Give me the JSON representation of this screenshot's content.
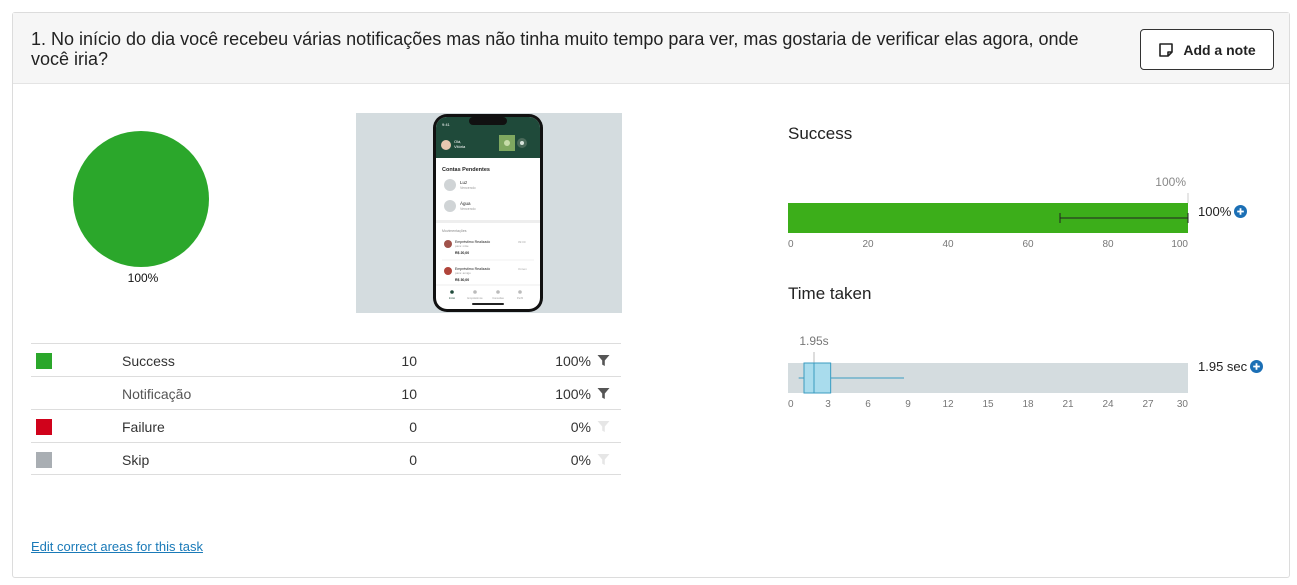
{
  "question": {
    "text": "1. No início do dia você recebeu várias notificações mas não tinha muito tempo para ver, mas gostaria de verificar elas agora, onde você iria?"
  },
  "toolbar": {
    "add_note_label": "Add a note"
  },
  "pie": {
    "label": "100%",
    "success_fraction": 1.0,
    "color": "#2ba72b"
  },
  "results": [
    {
      "label": "Success",
      "count": "10",
      "percent": "100%",
      "color": "#2ba72b",
      "filter_active": true
    },
    {
      "label": "Notificação",
      "count": "10",
      "percent": "100%",
      "color": null,
      "filter_active": true
    },
    {
      "label": "Failure",
      "count": "0",
      "percent": "0%",
      "color": "#d0021b",
      "filter_active": false
    },
    {
      "label": "Skip",
      "count": "0",
      "percent": "0%",
      "color": "#a9aeb3",
      "filter_active": false
    }
  ],
  "edit_link": "Edit correct areas for this task",
  "success_chart": {
    "title": "Success",
    "top_label": "100%",
    "side_value": "100%",
    "ticks": [
      "0",
      "20",
      "40",
      "60",
      "80",
      "100"
    ],
    "chart_data": {
      "type": "bar",
      "value": 100,
      "error_low": 68,
      "error_high": 100,
      "xlim": [
        0,
        100
      ],
      "color": "#3cae1a"
    }
  },
  "time_chart": {
    "title": "Time taken",
    "top_label": "1.95s",
    "side_value": "1.95 sec",
    "ticks": [
      "0",
      "3",
      "6",
      "9",
      "12",
      "15",
      "18",
      "21",
      "24",
      "27",
      "30"
    ],
    "chart_data": {
      "type": "box",
      "whisker_low": 0.8,
      "q1": 1.2,
      "median": 1.95,
      "q3": 3.2,
      "whisker_high": 8.7,
      "xlim": [
        0,
        30
      ],
      "color": "#a9dced"
    }
  },
  "phone": {
    "time": "9:41",
    "user_line1": "Olá,",
    "user_line2": "Vitória",
    "section_title": "Contas Pendentes",
    "bills": [
      {
        "title": "Luz",
        "sub": "Vencendo"
      },
      {
        "title": "Água",
        "sub": "Vencendo"
      }
    ],
    "notif_title": "Movimentações",
    "notifications": [
      {
        "title": "Empréstimo Realizado",
        "sub": "para: mãe",
        "amount": "R$ 20,00",
        "time": "09:00"
      },
      {
        "title": "Empréstimo Realizado",
        "sub": "para: amigo",
        "amount": "R$ 30,00",
        "time": "Ontem"
      }
    ],
    "nav": [
      "Início",
      "Empréstimos",
      "Consultas",
      "Perfil"
    ]
  }
}
